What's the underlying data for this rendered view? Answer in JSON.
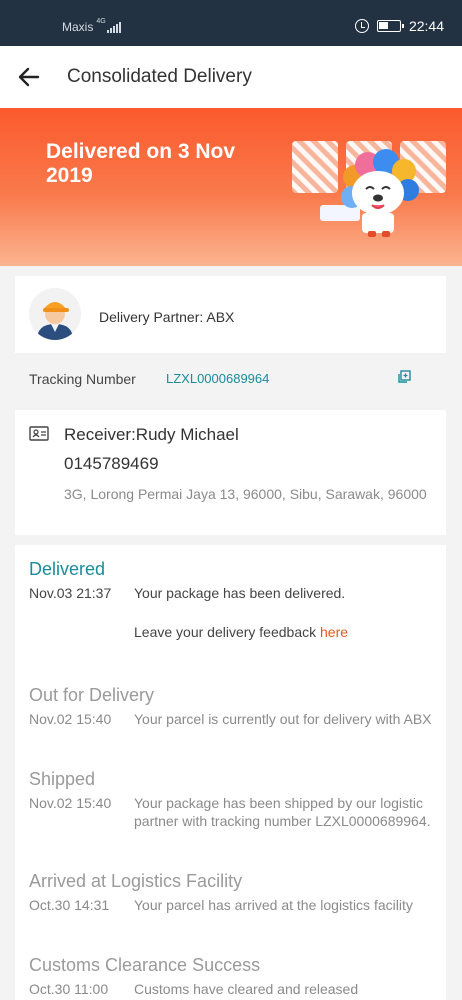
{
  "status_bar": {
    "carrier": "Maxis",
    "network": "4G",
    "time": "22:44"
  },
  "app_bar": {
    "title": "Consolidated Delivery"
  },
  "banner": {
    "title": "Delivered on 3 Nov 2019"
  },
  "partner": {
    "label": "Delivery Partner: ABX"
  },
  "tracking": {
    "label": "Tracking Number",
    "number": "LZXL0000689964"
  },
  "receiver": {
    "name": "Receiver:Rudy Michael",
    "phone": "0145789469",
    "address": "3G, Lorong Permai Jaya 13, 96000, Sibu, Sarawak, 96000"
  },
  "timeline": [
    {
      "title": "Delivered",
      "time": "Nov.03 21:37",
      "desc": "Your package has been delivered.",
      "feedback_text": "Leave your delivery feedback ",
      "feedback_link": "here"
    },
    {
      "title": "Out for Delivery",
      "time": "Nov.02 15:40",
      "desc": "Your parcel is currently out for delivery with ABX"
    },
    {
      "title": "Shipped",
      "time": "Nov.02 15:40",
      "desc": "Your package has been shipped by our logistic partner with tracking number LZXL0000689964."
    },
    {
      "title": "Arrived at Logistics Facility",
      "time": "Oct.30 14:31",
      "desc": "Your parcel has arrived at the logistics facility"
    },
    {
      "title": "Customs Clearance Success",
      "time": "Oct.30 11:00",
      "desc": "Customs have cleared and released"
    }
  ],
  "colors": {
    "accent": "#1a8b9b",
    "banner": "#fb5a2d",
    "link": "#e05a1f",
    "status_bar": "#233242"
  }
}
